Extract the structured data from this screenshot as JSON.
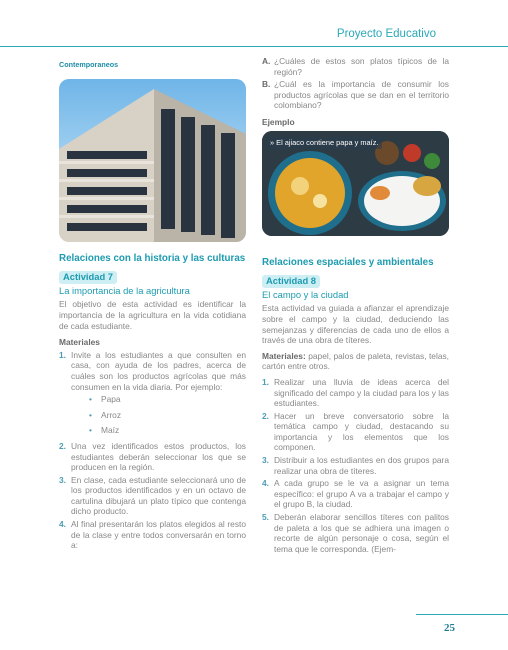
{
  "header": {
    "title": "Proyecto Educativo"
  },
  "left": {
    "section_label": "Contemporaneos",
    "section_title": "Relaciones con la historia y las culturas",
    "activity_badge": "Actividad 7",
    "activity_title": "La importancia de la agricultura",
    "intro": "El objetivo de esta actividad es identificar la importancia de la agricultura en la vida cotidiana de cada estudiante.",
    "materials_heading": "Materiales",
    "steps": [
      {
        "num": "1.",
        "text": "Invite a los estudiantes a que consulten en casa, con ayuda de los padres, acerca de cuáles son los productos agrícolas que más consumen en la vida diaria. Por ejemplo:"
      },
      {
        "num": "2.",
        "text": "Una vez identificados estos productos, los estudiantes deberán seleccionar los que se producen en la región."
      },
      {
        "num": "3.",
        "text": "En clase, cada estudiante seleccionará uno de los productos identificados y en un octavo de cartulina dibujará un plato típico que contenga dicho producto."
      },
      {
        "num": "4.",
        "text": "Al final presentarán los platos elegidos al resto de la clase y entre todos conversarán en torno a:"
      }
    ],
    "examples": [
      "Papa",
      "Arroz",
      "Maíz"
    ]
  },
  "right": {
    "questions": [
      {
        "letter": "A.",
        "text": "¿Cuáles de estos son platos típicos de la región?"
      },
      {
        "letter": "B.",
        "text": "¿Cuál es la importancia de consumir los productos agrícolas que se dan en el territorio colombiano?"
      }
    ],
    "example_heading": "Ejemplo",
    "image_caption": "» El ajiaco contiene papa y maíz.",
    "section_title": "Relaciones espaciales y ambientales",
    "activity_badge": "Actividad 8",
    "activity_title": "El campo y la ciudad",
    "intro": "Esta actividad va guiada a afianzar el aprendizaje sobre el campo y la ciudad, deduciendo las semejanzas y diferencias de cada uno de ellos a través de una obra de títeres.",
    "materials_label": "Materiales:",
    "materials_text": " papel, palos de paleta, revistas, telas, cartón entre otros.",
    "steps": [
      {
        "num": "1.",
        "text": "Realizar una lluvia de ideas acerca del significado del campo y la ciudad para los y las estudiantes."
      },
      {
        "num": "2.",
        "text": "Hacer un breve conversatorio sobre la temática campo y ciudad, destacando su importancia y los elementos que los componen."
      },
      {
        "num": "3.",
        "text": "Distribuir a los estudiantes en dos grupos para realizar una obra de títeres."
      },
      {
        "num": "4.",
        "text": "A cada grupo se le va a asignar un tema específico: el grupo A va a trabajar el campo y el grupo B, la ciudad."
      },
      {
        "num": "5.",
        "text": "Deberán elaborar sencillos títeres con palitos de paleta a los que se adhiera una imagen o recorte de algún personaje o cosa, según el tema que le corresponda. (Ejem-"
      }
    ]
  },
  "footer": {
    "page_number": "25"
  }
}
